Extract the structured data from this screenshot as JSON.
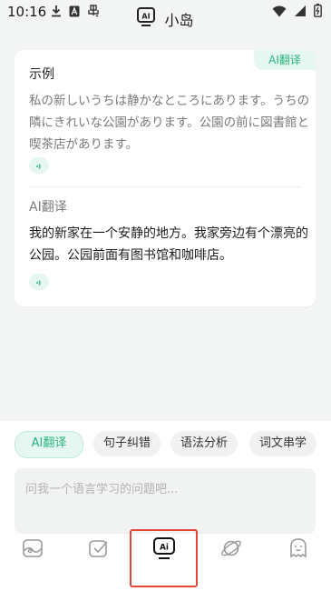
{
  "status_bar": {
    "time": "10:16",
    "left_icons": [
      "download-icon",
      "a-box-icon",
      "notification-icon"
    ],
    "right_icons": [
      "wifi-icon",
      "signal-icon",
      "battery-icon"
    ]
  },
  "header": {
    "logo_text": "AI",
    "title": "小岛"
  },
  "card": {
    "badge": "AI翻译",
    "sample_label": "示例",
    "sample_text": "私の新しいうちは静かなところにあります。うちの隣にきれいな公園があります。公園の前に図書館と喫茶店があります。",
    "ai_label": "AI翻译",
    "translation_text": "我的新家在一个安静的地方。我家旁边有个漂亮的公园。公园前面有图书馆和咖啡店。"
  },
  "chips": [
    {
      "label": "AI翻译",
      "active": true
    },
    {
      "label": "句子纠错",
      "active": false
    },
    {
      "label": "语法分析",
      "active": false
    },
    {
      "label": "词文串学",
      "active": false
    }
  ],
  "chat_input": {
    "placeholder": "问我一个语言学习的问题吧..."
  },
  "bottom_nav": {
    "items": [
      "picture-icon",
      "checkbox-icon",
      "ai-chat-icon",
      "planet-icon",
      "ghost-icon"
    ],
    "ai_text": "Ai"
  },
  "colors": {
    "accent": "#2ab37f",
    "accent_bg": "#e6f7f1",
    "highlight": "#e4473b"
  }
}
